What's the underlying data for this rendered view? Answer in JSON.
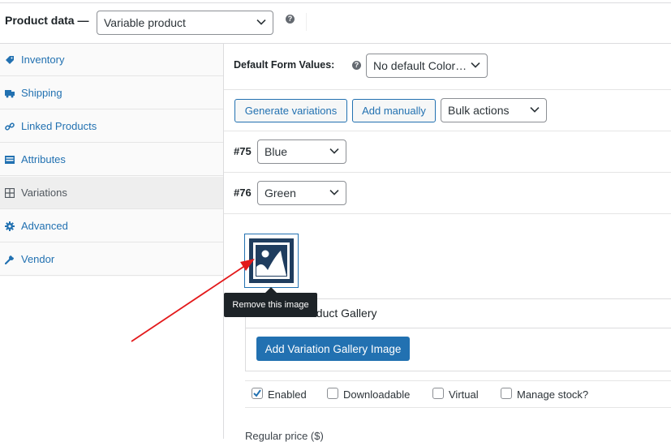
{
  "header": {
    "title": "Product data —",
    "product_type": "Variable product",
    "help": "?"
  },
  "sidebar": {
    "items": [
      {
        "label": "Inventory",
        "icon": "tag-icon"
      },
      {
        "label": "Shipping",
        "icon": "truck-icon"
      },
      {
        "label": "Linked Products",
        "icon": "link-icon"
      },
      {
        "label": "Attributes",
        "icon": "list-icon"
      },
      {
        "label": "Variations",
        "icon": "grid-icon",
        "active": true
      },
      {
        "label": "Advanced",
        "icon": "gear-icon"
      },
      {
        "label": "Vendor",
        "icon": "wrench-icon"
      }
    ]
  },
  "defaults": {
    "label": "Default Form Values:",
    "help": "?",
    "value": "No default Color…"
  },
  "actions": {
    "generate": "Generate variations",
    "add_manually": "Add manually",
    "bulk": "Bulk actions"
  },
  "variations": [
    {
      "number": "#75",
      "value": "Blue"
    },
    {
      "number": "#76",
      "value": "Green"
    }
  ],
  "gallery": {
    "tooltip": "Remove this image",
    "title": "Variation Product Gallery",
    "visible_title": "oduct Gallery",
    "add_button": "Add Variation Gallery Image"
  },
  "options": {
    "enabled": {
      "label": "Enabled",
      "checked": true
    },
    "downloadable": {
      "label": "Downloadable",
      "checked": false
    },
    "virtual": {
      "label": "Virtual",
      "checked": false
    },
    "manage_stock": {
      "label": "Manage stock?",
      "checked": false
    }
  },
  "pricing": {
    "regular_price_label": "Regular price ($)"
  },
  "colors": {
    "link": "#2271b1",
    "annotation_arrow": "#e3191b",
    "tooltip_bg": "#1d2327"
  }
}
